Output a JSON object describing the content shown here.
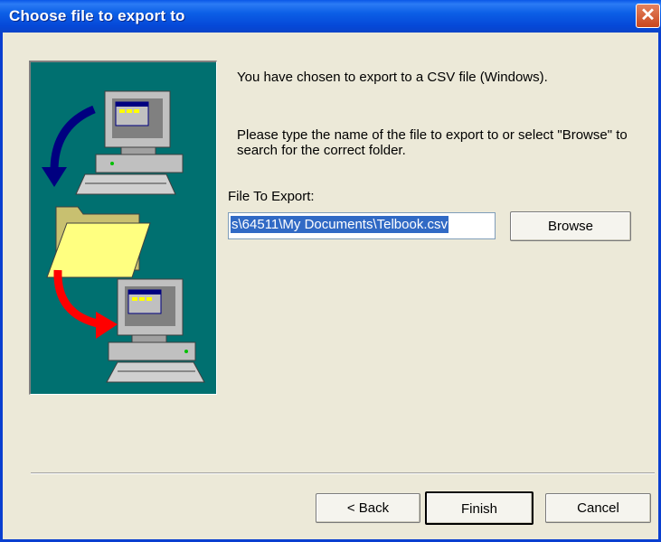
{
  "window": {
    "title": "Choose file to export to",
    "close_label": "✕"
  },
  "content": {
    "intro": "You have chosen to export to a CSV file (Windows).",
    "instructions": "Please type the name of the file to export to or select \"Browse\" to search for the correct folder.",
    "field_label": "File To Export:",
    "field_value": "s\\64511\\My Documents\\Telbook.csv"
  },
  "buttons": {
    "browse": "Browse",
    "back": "< Back",
    "finish": "Finish",
    "cancel": "Cancel"
  },
  "colors": {
    "title_bar": "#0a58e8",
    "panel": "#007070",
    "selection": "#316ac5",
    "dialog_bg": "#ece9d8"
  },
  "icons": [
    "close-icon",
    "computer-icon",
    "folder-icon",
    "arrow-icon"
  ]
}
